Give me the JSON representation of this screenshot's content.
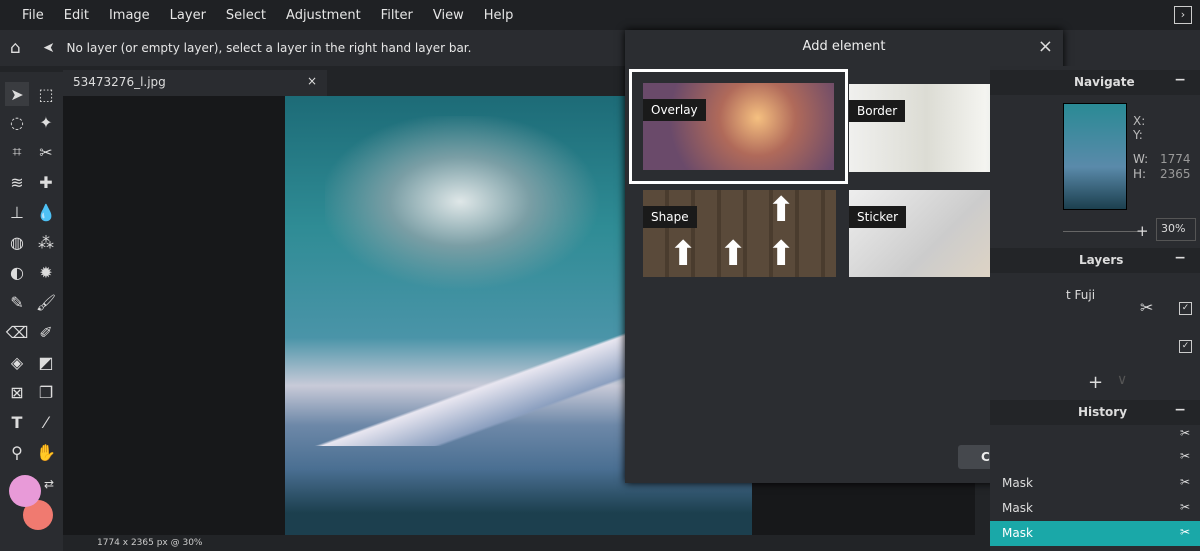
{
  "menu": [
    "File",
    "Edit",
    "Image",
    "Layer",
    "Select",
    "Adjustment",
    "Filter",
    "View",
    "Help"
  ],
  "toolbar": {
    "message": "No layer (or empty layer), select a layer in the right hand layer bar."
  },
  "document": {
    "tab": "53473276_l.jpg",
    "close": "×",
    "status": "1774 x 2365 px @ 30%"
  },
  "dialog": {
    "title": "Add element",
    "close_x": "×",
    "close_button": "CLOSE",
    "tiles": [
      {
        "label": "Overlay",
        "selected": true
      },
      {
        "label": "Border"
      },
      {
        "label": "Shape"
      },
      {
        "label": "Sticker"
      }
    ]
  },
  "navigate": {
    "title": "Navigate",
    "x_label": "X:",
    "y_label": "Y:",
    "w_label": "W:",
    "w": "1774",
    "h_label": "H:",
    "h": "2365",
    "zoom": "30%"
  },
  "layers": {
    "title": "Layers",
    "items": [
      "t Fuji"
    ]
  },
  "history": {
    "title": "History",
    "items": [
      "Mask",
      "Mask",
      "Mask"
    ]
  },
  "colors": {
    "primary": "#e89ad8",
    "secondary": "#f07a70",
    "accent": "#1aa8a8"
  }
}
